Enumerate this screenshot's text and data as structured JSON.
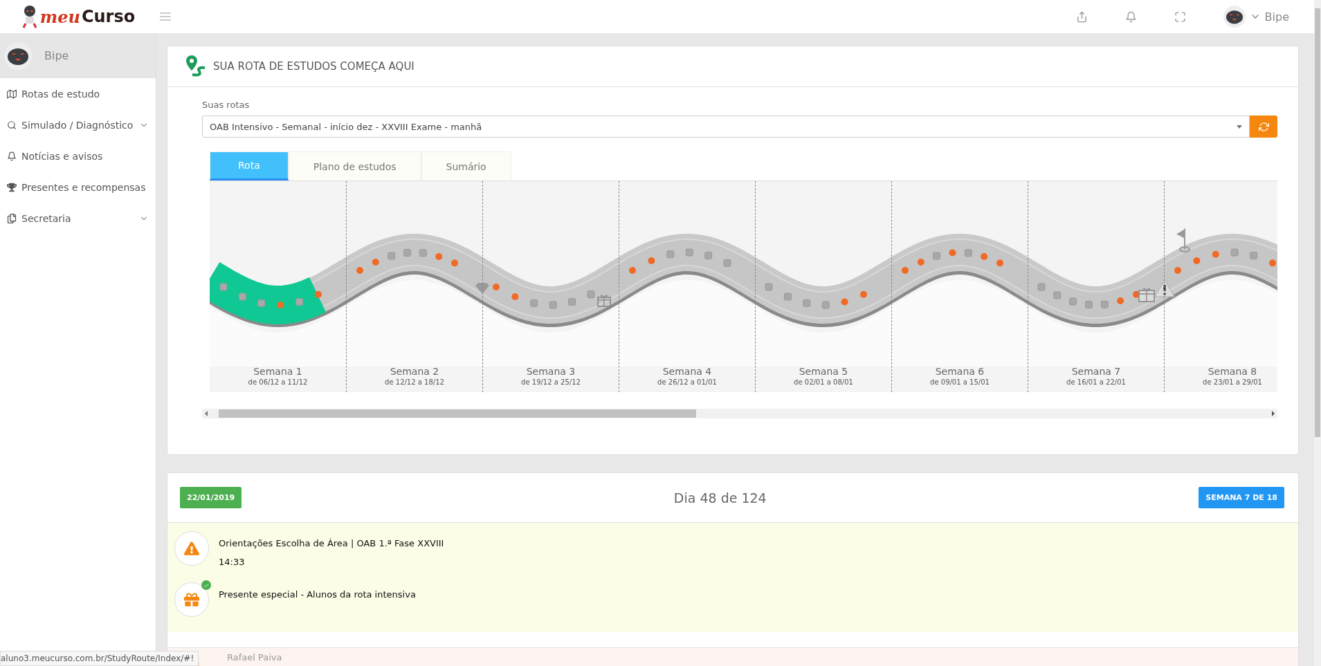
{
  "header": {
    "logo": {
      "prefix": "meu",
      "name": "Curso"
    },
    "user": "Bipe"
  },
  "sidebar": {
    "user": "Bipe",
    "items": [
      {
        "label": "Rotas de estudo",
        "kind": "link",
        "expanded": false
      },
      {
        "label": "Simulado / Diagnóstico",
        "kind": "group",
        "expanded": false
      },
      {
        "label": "Notícias e avisos",
        "kind": "link",
        "expanded": false
      },
      {
        "label": "Presentes e recompensas",
        "kind": "link",
        "expanded": false
      },
      {
        "label": "Secretaria",
        "kind": "group",
        "expanded": false
      }
    ]
  },
  "route_card": {
    "title": "SUA ROTA DE ESTUDOS COMEÇA AQUI",
    "select_label": "Suas rotas",
    "select_value": "OAB Intensivo - Semanal - início dez - XXVIII Exame - manhã",
    "tabs": [
      {
        "label": "Rota",
        "selected": true
      },
      {
        "label": "Plano de estudos",
        "selected": false
      },
      {
        "label": "Sumário",
        "selected": false
      }
    ],
    "weeks": [
      {
        "label": "Semana 1",
        "dates": "de 06/12 a 11/12",
        "steps": [
          {
            "done": false
          },
          {
            "done": false
          },
          {
            "done": false
          },
          {
            "done": true
          },
          {
            "done": false
          },
          {
            "done": true
          }
        ]
      },
      {
        "label": "Semana 2",
        "dates": "de 12/12 a 18/12",
        "steps": [
          {
            "done": true
          },
          {
            "done": true
          },
          {
            "done": false
          },
          {
            "done": false
          },
          {
            "done": false
          },
          {
            "done": true
          },
          {
            "done": true
          }
        ]
      },
      {
        "label": "Semana 3",
        "dates": "de 19/12 a 25/12",
        "steps": [
          {
            "done": true
          },
          {
            "done": true
          },
          {
            "done": false
          },
          {
            "done": false
          },
          {
            "done": false
          },
          {
            "done": false
          }
        ]
      },
      {
        "label": "Semana 4",
        "dates": "de 26/12 a 01/01",
        "steps": [
          {
            "done": true
          },
          {
            "done": true
          },
          {
            "done": false
          },
          {
            "done": false
          },
          {
            "done": false
          },
          {
            "done": false
          }
        ]
      },
      {
        "label": "Semana 5",
        "dates": "de 02/01 a 08/01",
        "steps": [
          {
            "done": false
          },
          {
            "done": false
          },
          {
            "done": false
          },
          {
            "done": false
          },
          {
            "done": true
          },
          {
            "done": true
          }
        ]
      },
      {
        "label": "Semana 6",
        "dates": "de 09/01 a 15/01",
        "steps": [
          {
            "done": true
          },
          {
            "done": true
          },
          {
            "done": false
          },
          {
            "done": true
          },
          {
            "done": false
          },
          {
            "done": true
          },
          {
            "done": true
          }
        ]
      },
      {
        "label": "Semana 7",
        "dates": "de 16/01 a 22/01",
        "steps": [
          {
            "done": false
          },
          {
            "done": false
          },
          {
            "done": false
          },
          {
            "done": false
          },
          {
            "done": false
          },
          {
            "done": true
          },
          {
            "done": true
          }
        ]
      },
      {
        "label": "Semana 8",
        "dates": "de 23/01 a 29/01",
        "steps": [
          {
            "done": true
          },
          {
            "done": true
          },
          {
            "done": true
          },
          {
            "done": false
          },
          {
            "done": false
          },
          {
            "done": true
          }
        ]
      }
    ]
  },
  "day_card": {
    "date": "22/01/2019",
    "day": "Dia 48 de 124",
    "week": "SEMANA 7 DE 18",
    "events": [
      {
        "kind": "warning",
        "title": "Orientações Escolha de Área | OAB 1.ª Fase XXVIII",
        "time": "14:33",
        "completed": false
      },
      {
        "kind": "gift",
        "title": "Presente especial - Alunos da rota intensiva",
        "completed": true
      }
    ],
    "next_author": "Rafael Paiva"
  },
  "status_bar": "aluno3.meucurso.com.br/StudyRoute/Index/#!"
}
